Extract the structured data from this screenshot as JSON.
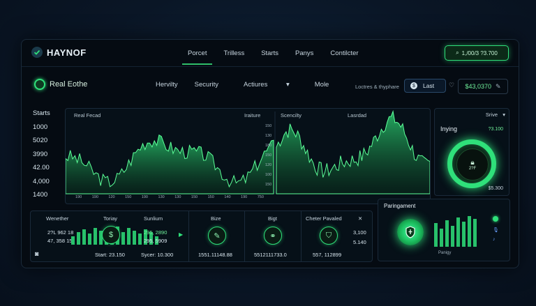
{
  "topbar": {
    "logo": "HAYNOF",
    "nav": [
      "Porcet",
      "Trilless",
      "Starts",
      "Panys",
      "Contilcter"
    ],
    "pill": "1,/00/3 ?3.700"
  },
  "subbar": {
    "brand": "Real Eothe",
    "nav": [
      "Hervilty",
      "Security",
      "Actiures",
      "Mole"
    ],
    "right_label": "Loctres & thyphare",
    "last_label": "Last",
    "price": "$43,0370"
  },
  "left_axis": {
    "title": "Starts",
    "values": [
      "1000",
      "5020",
      "3990",
      "42.00",
      "4,000",
      "1400"
    ]
  },
  "chart": {
    "left_title": "Real Fecad",
    "left_right_title": "Iraiture",
    "center_title": "Scencilty",
    "center_title2": "Lasrdad",
    "ticks": [
      "150",
      "130",
      "180",
      "150",
      "120",
      "100",
      "150"
    ],
    "x_ticks": [
      "190",
      "190",
      "120",
      "150",
      "190",
      "130",
      "130",
      "150",
      "150",
      "140",
      "190",
      "750"
    ],
    "accent": "#2fe07a"
  },
  "right_panel": {
    "dropdown": "Srive",
    "label": "Inying",
    "value": "?3.100",
    "ring_value": "2?F",
    "bottom_value": "$5.300"
  },
  "bottom": {
    "headers": [
      "Wenether",
      "Toriay",
      "Sunlium",
      "Bize",
      "Bigt",
      "Cheter Pavaled"
    ],
    "left_vals": [
      "2?L 962 18",
      "47, 358 15"
    ],
    "right_vals": [
      "295, 2890",
      "295, 5909"
    ],
    "start_label": "Start: 23.150",
    "sycer_label": "Sycer: 10.300",
    "bize_value": "1551.11148.88",
    "bigt_value": "5512111733.0",
    "cheter_value": "557, 112899",
    "side_vals": [
      "3,100",
      "5.140"
    ],
    "close": "✕"
  },
  "pay_panel": {
    "title": "Paringament",
    "footer": "Panigy"
  },
  "icons": {
    "logo": "check-icon",
    "dollar": "$"
  }
}
